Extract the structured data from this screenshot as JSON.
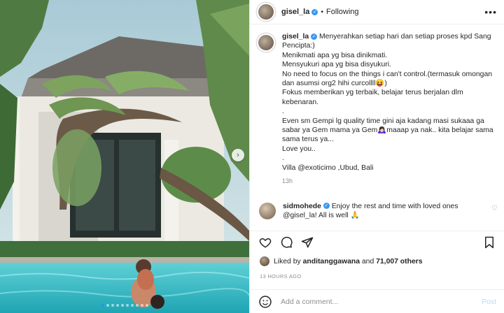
{
  "post": {
    "username": "gisel_la",
    "follow_status": "Following",
    "caption_lines": [
      "Menyerahkan setiap hari dan setiap proses kpd Sang Pencipta:)",
      "Menikmati apa yg bisa dinikmati.",
      "Mensyukuri apa yg bisa disyukuri.",
      "No need to focus on the things i can't control.(termasuk omongan dan asumsi org2 hihi curcollll😝)",
      "Fokus memberikan yg terbaik, belajar terus berjalan dlm kebenaran.",
      ".",
      "Even sm Gempi lg quality time gini aja kadang masi sukaaa ga sabar ya Gem mama ya Gem🙇🏻‍♀️maaap ya nak.. kita belajar sama sama terus ya...",
      "Love you..",
      ".",
      "Villa @exoticimo ,Ubud, Bali"
    ],
    "time_ago": "13h",
    "comment": {
      "username": "sidmohede",
      "text": "Enjoy the rest and time with loved ones @gisel_la! All is well 🙏"
    },
    "likes": {
      "prefix": "Liked by",
      "user": "anditanggawana",
      "conj": "and",
      "others": "71,007 others"
    },
    "posted": "13 HOURS AGO",
    "add_comment_placeholder": "Add a comment...",
    "post_button": "Post"
  },
  "carousel": {
    "dot_count": 10,
    "active_index": 0
  },
  "icons": {
    "more": "more-options-icon",
    "like": "heart-icon",
    "comment": "comment-icon",
    "share": "share-icon",
    "save": "bookmark-icon",
    "emoji": "emoji-icon",
    "next": "chevron-right-icon"
  },
  "colors": {
    "verified": "#3897f0",
    "link": "#00376b",
    "muted": "#8e8e8e",
    "post_disabled": "#b2dffc"
  }
}
